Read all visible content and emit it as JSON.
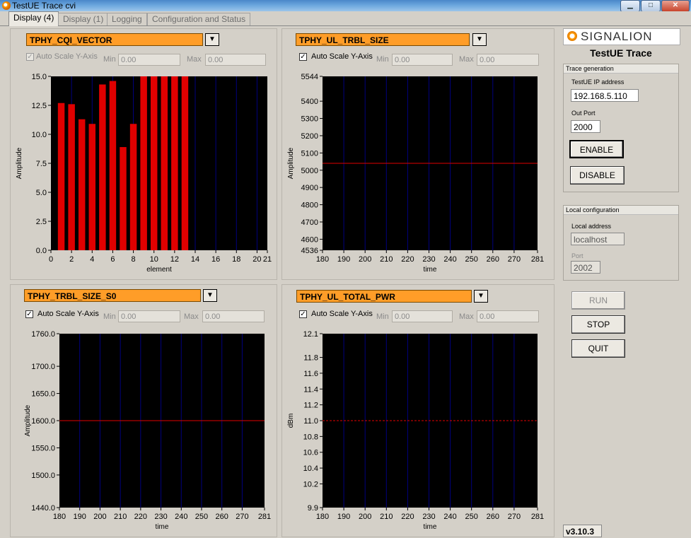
{
  "window": {
    "title": "TestUE Trace cvi",
    "controls": {
      "minimize": "▁",
      "maximize": "□",
      "close": "✕"
    }
  },
  "tabs": [
    {
      "label": "Display (4)",
      "active": true
    },
    {
      "label": "Display (1)",
      "active": false
    },
    {
      "label": "Logging",
      "active": false
    },
    {
      "label": "Configuration and Status",
      "active": false
    }
  ],
  "colors": {
    "selector": "#ff9d28",
    "trace": "#e00000",
    "grid": "#00007f",
    "plot_bg": "#000000"
  },
  "panels": [
    {
      "selector": "TPHY_CQI_VECTOR",
      "autoscale": {
        "label": "Auto Scale Y-Axis",
        "checked": true,
        "disabled": true
      },
      "min": {
        "label": "Min",
        "value": "0.00"
      },
      "max": {
        "label": "Max",
        "value": "0.00"
      }
    },
    {
      "selector": "TPHY_UL_TRBL_SIZE",
      "autoscale": {
        "label": "Auto Scale Y-Axis",
        "checked": true,
        "disabled": false
      },
      "min": {
        "label": "Min",
        "value": "0.00"
      },
      "max": {
        "label": "Max",
        "value": "0.00"
      }
    },
    {
      "selector": "TPHY_TRBL_SIZE_S0",
      "autoscale": {
        "label": "Auto Scale Y-Axis",
        "checked": true,
        "disabled": false
      },
      "min": {
        "label": "Min",
        "value": "0.00"
      },
      "max": {
        "label": "Max",
        "value": "0.00"
      }
    },
    {
      "selector": "TPHY_UL_TOTAL_PWR",
      "autoscale": {
        "label": "Auto Scale Y-Axis",
        "checked": true,
        "disabled": false
      },
      "min": {
        "label": "Min",
        "value": "0.00"
      },
      "max": {
        "label": "Max",
        "value": "0.00"
      }
    }
  ],
  "chart_data": [
    {
      "type": "bar",
      "xlabel": "element",
      "ylabel": "Amplitude",
      "x": [
        1,
        2,
        3,
        4,
        5,
        6,
        7,
        8,
        9,
        10,
        11,
        12,
        13
      ],
      "values": [
        12.7,
        12.6,
        11.3,
        10.9,
        14.3,
        14.6,
        8.9,
        10.9,
        15,
        15,
        15,
        15,
        15
      ],
      "xlim": [
        0,
        21
      ],
      "ylim": [
        0,
        15
      ],
      "xticks": [
        "0",
        "2",
        "4",
        "6",
        "8",
        "10",
        "12",
        "14",
        "16",
        "18",
        "20",
        "21"
      ],
      "yticks": [
        "0.0",
        "2.5",
        "5.0",
        "7.5",
        "10.0",
        "12.5",
        "15.0"
      ]
    },
    {
      "type": "line",
      "xlabel": "time",
      "ylabel": "Amplitude",
      "x": [
        180,
        281
      ],
      "values": [
        5040,
        5040
      ],
      "xlim": [
        180,
        281
      ],
      "ylim": [
        4536,
        5544
      ],
      "xticks": [
        "180",
        "190",
        "200",
        "210",
        "220",
        "230",
        "240",
        "250",
        "260",
        "270",
        "281"
      ],
      "yticks": [
        "4536",
        "4600",
        "4700",
        "4800",
        "4900",
        "5000",
        "5100",
        "5200",
        "5300",
        "5400",
        "5544"
      ]
    },
    {
      "type": "line",
      "xlabel": "time",
      "ylabel": "Amplitude",
      "x": [
        180,
        281
      ],
      "values": [
        1600,
        1600
      ],
      "xlim": [
        180,
        281
      ],
      "ylim": [
        1440,
        1760
      ],
      "xticks": [
        "180",
        "190",
        "200",
        "210",
        "220",
        "230",
        "240",
        "250",
        "260",
        "270",
        "281"
      ],
      "yticks": [
        "1440.0",
        "1500.0",
        "1550.0",
        "1600.0",
        "1650.0",
        "1700.0",
        "1760.0"
      ]
    },
    {
      "type": "line",
      "xlabel": "time",
      "ylabel": "dBm",
      "dashed": true,
      "x": [
        180,
        281
      ],
      "values": [
        11.0,
        11.0
      ],
      "xlim": [
        180,
        281
      ],
      "ylim": [
        9.9,
        12.1
      ],
      "xticks": [
        "180",
        "190",
        "200",
        "210",
        "220",
        "230",
        "240",
        "250",
        "260",
        "270",
        "281"
      ],
      "yticks": [
        "9.9",
        "10.2",
        "10.4",
        "10.6",
        "10.8",
        "11.0",
        "11.2",
        "11.4",
        "11.6",
        "11.8",
        "12.1"
      ]
    }
  ],
  "sidebar": {
    "logo": "SIGNALION",
    "app_title": "TestUE Trace",
    "trace_generation": {
      "header": "Trace generation",
      "ip_label": "TestUE IP address",
      "ip_value": "192.168.5.110",
      "port_label": "Out Port",
      "port_value": "2000",
      "enable": "ENABLE",
      "disable": "DISABLE"
    },
    "local_configuration": {
      "header": "Local configuration",
      "address_label": "Local address",
      "address_value": "localhost",
      "port_label": "Port",
      "port_value": "2002"
    },
    "run": "RUN",
    "stop": "STOP",
    "quit": "QUIT",
    "version": "v3.10.3"
  }
}
